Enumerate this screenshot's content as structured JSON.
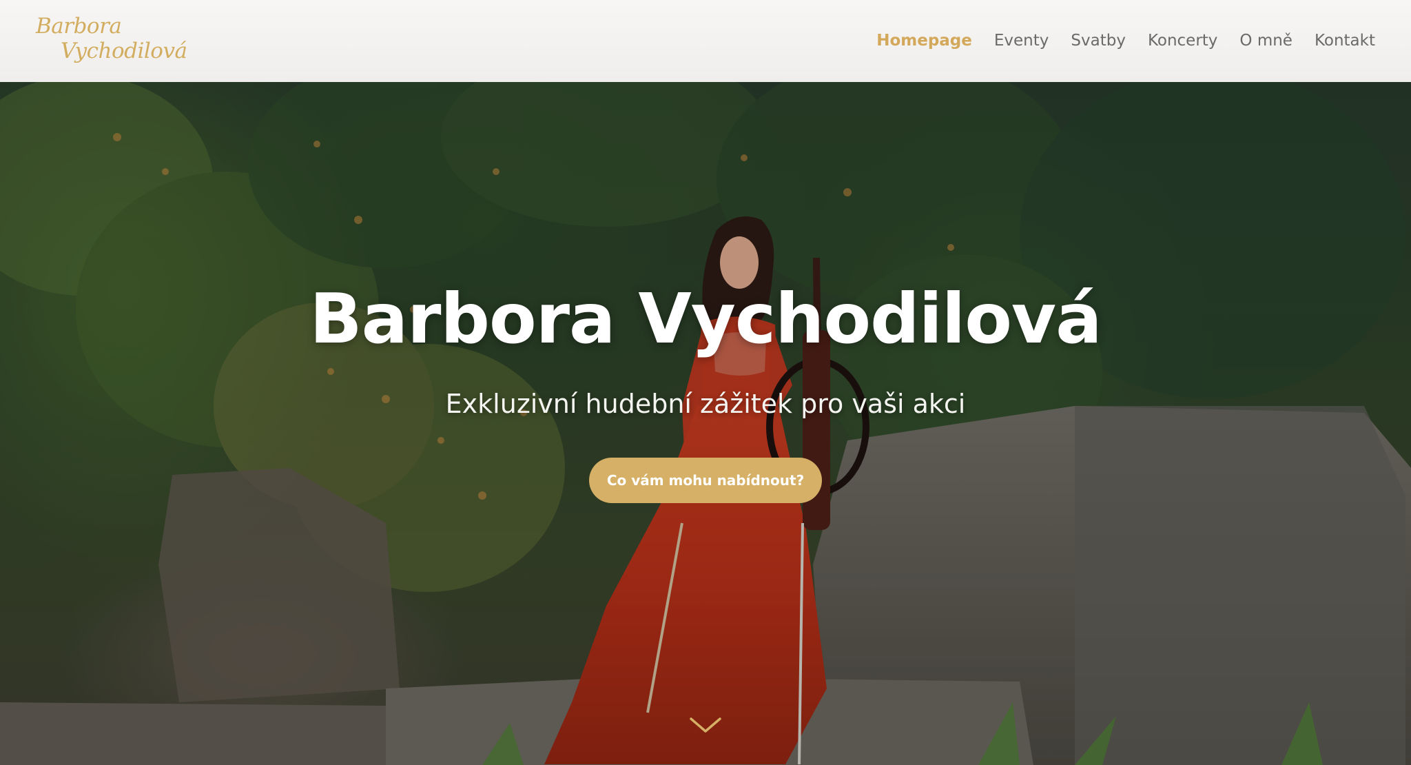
{
  "header": {
    "logo_line1": "Barbora",
    "logo_line2": "Vychodilová",
    "nav": [
      {
        "label": "Homepage",
        "active": true
      },
      {
        "label": "Eventy"
      },
      {
        "label": "Svatby"
      },
      {
        "label": "Koncerty"
      },
      {
        "label": "O mně"
      },
      {
        "label": "Kontakt"
      }
    ]
  },
  "hero": {
    "title": "Barbora Vychodilová",
    "subtitle": "Exkluzivní hudební zážitek pro vaši akci",
    "cta_label": "Co vám mohu nabídnout?",
    "scroll_icon": "chevron-down-icon"
  },
  "colors": {
    "accent": "#d6b066",
    "nav_active": "#d3a85a",
    "nav_text": "#6a6a6a",
    "header_bg": "#f3f2f0",
    "dress": "#b8331c"
  }
}
